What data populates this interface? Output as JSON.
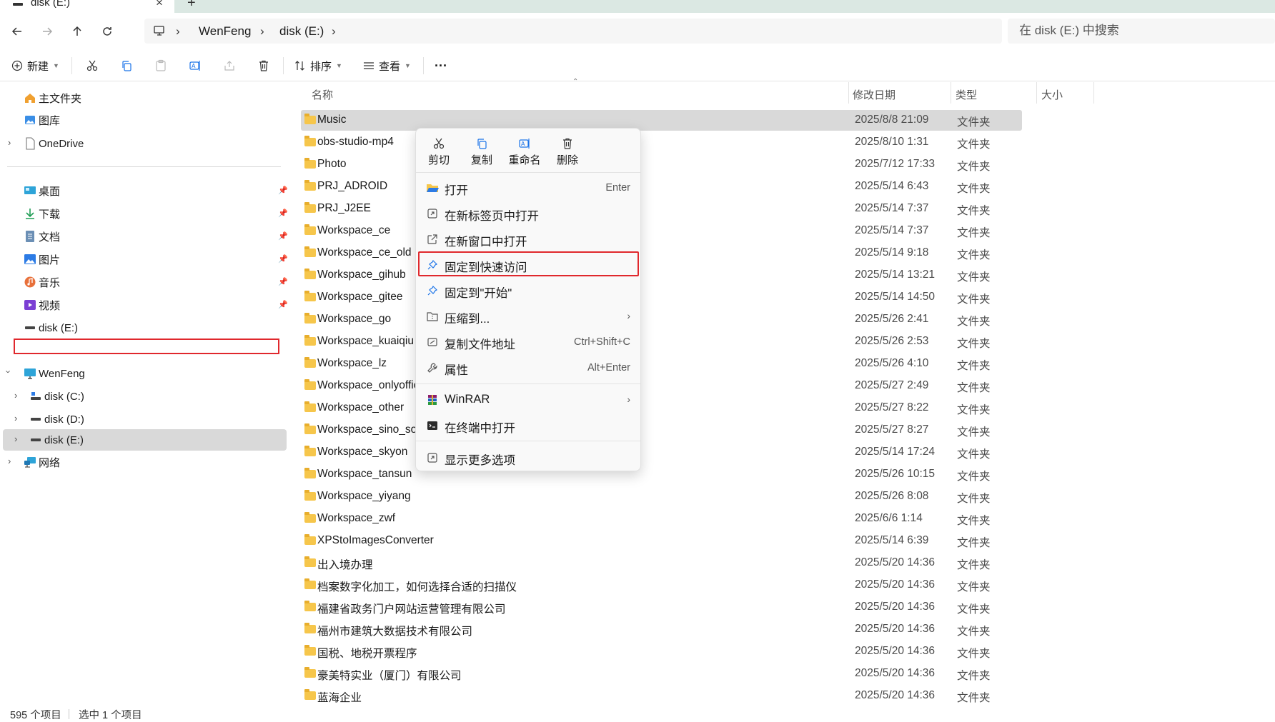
{
  "tab": {
    "label": "disk (E:)",
    "close": "×",
    "new_tab": "+"
  },
  "address": {
    "segments": [
      "WenFeng",
      "disk (E:)"
    ],
    "separator": "›"
  },
  "search": {
    "placeholder": "在 disk (E:) 中搜索"
  },
  "toolbar": {
    "new_label": "新建",
    "sort_label": "排序",
    "view_label": "查看",
    "more": "···"
  },
  "sidebar": {
    "home": "主文件夹",
    "gallery": "图库",
    "onedrive": "OneDrive",
    "quick": [
      {
        "label": "桌面",
        "icon": "desktop-icon"
      },
      {
        "label": "下载",
        "icon": "download-icon"
      },
      {
        "label": "文档",
        "icon": "document-icon"
      },
      {
        "label": "图片",
        "icon": "pictures-icon"
      },
      {
        "label": "音乐",
        "icon": "music-icon"
      },
      {
        "label": "视频",
        "icon": "video-icon"
      },
      {
        "label": "disk (E:)",
        "icon": "drive-icon"
      }
    ],
    "pc": "WenFeng",
    "drives": [
      "disk (C:)",
      "disk (D:)",
      "disk (E:)"
    ],
    "network": "网络"
  },
  "columns": {
    "name": "名称",
    "date": "修改日期",
    "type": "类型",
    "size": "大小"
  },
  "files": [
    {
      "name": "Music",
      "date": "2025/8/8 21:09",
      "type": "文件夹"
    },
    {
      "name": "obs-studio-mp4",
      "date": "2025/8/10 1:31",
      "type": "文件夹"
    },
    {
      "name": "Photo",
      "date": "2025/7/12 17:33",
      "type": "文件夹"
    },
    {
      "name": "PRJ_ADROID",
      "date": "2025/5/14 6:43",
      "type": "文件夹"
    },
    {
      "name": "PRJ_J2EE",
      "date": "2025/5/14 7:37",
      "type": "文件夹"
    },
    {
      "name": "Workspace_ce",
      "date": "2025/5/14 7:37",
      "type": "文件夹"
    },
    {
      "name": "Workspace_ce_old",
      "date": "2025/5/14 9:18",
      "type": "文件夹"
    },
    {
      "name": "Workspace_gihub",
      "date": "2025/5/14 13:21",
      "type": "文件夹"
    },
    {
      "name": "Workspace_gitee",
      "date": "2025/5/14 14:50",
      "type": "文件夹"
    },
    {
      "name": "Workspace_go",
      "date": "2025/5/26 2:41",
      "type": "文件夹"
    },
    {
      "name": "Workspace_kuaiqiu",
      "date": "2025/5/26 2:53",
      "type": "文件夹"
    },
    {
      "name": "Workspace_lz",
      "date": "2025/5/26 4:10",
      "type": "文件夹"
    },
    {
      "name": "Workspace_onlyoffice",
      "date": "2025/5/27 2:49",
      "type": "文件夹"
    },
    {
      "name": "Workspace_other",
      "date": "2025/5/27 8:22",
      "type": "文件夹"
    },
    {
      "name": "Workspace_sino_soft",
      "date": "2025/5/27 8:27",
      "type": "文件夹"
    },
    {
      "name": "Workspace_skyon",
      "date": "2025/5/14 17:24",
      "type": "文件夹"
    },
    {
      "name": "Workspace_tansun",
      "date": "2025/5/26 10:15",
      "type": "文件夹"
    },
    {
      "name": "Workspace_yiyang",
      "date": "2025/5/26 8:08",
      "type": "文件夹"
    },
    {
      "name": "Workspace_zwf",
      "date": "2025/6/6 1:14",
      "type": "文件夹"
    },
    {
      "name": "XPStoImagesConverter",
      "date": "2025/5/14 6:39",
      "type": "文件夹"
    },
    {
      "name": "出入境办理",
      "date": "2025/5/20 14:36",
      "type": "文件夹"
    },
    {
      "name": "档案数字化加工，如何选择合适的扫描仪",
      "date": "2025/5/20 14:36",
      "type": "文件夹"
    },
    {
      "name": "福建省政务门户网站运营管理有限公司",
      "date": "2025/5/20 14:36",
      "type": "文件夹"
    },
    {
      "name": "福州市建筑大数据技术有限公司",
      "date": "2025/5/20 14:36",
      "type": "文件夹"
    },
    {
      "name": "国税、地税开票程序",
      "date": "2025/5/20 14:36",
      "type": "文件夹"
    },
    {
      "name": "豪美特实业（厦门）有限公司",
      "date": "2025/5/20 14:36",
      "type": "文件夹"
    },
    {
      "name": "蓝海企业",
      "date": "2025/5/20 14:36",
      "type": "文件夹"
    }
  ],
  "context_menu": {
    "quick_actions": [
      {
        "label": "剪切",
        "icon": "scissors-icon"
      },
      {
        "label": "复制",
        "icon": "copy-icon"
      },
      {
        "label": "重命名",
        "icon": "rename-icon"
      },
      {
        "label": "删除",
        "icon": "trash-icon"
      }
    ],
    "items": [
      {
        "label": "打开",
        "shortcut": "Enter",
        "icon": "folder-open-icon"
      },
      {
        "label": "在新标签页中打开",
        "shortcut": "",
        "icon": "new-tab-icon"
      },
      {
        "label": "在新窗口中打开",
        "shortcut": "",
        "icon": "new-window-icon"
      },
      {
        "label": "固定到快速访问",
        "shortcut": "",
        "icon": "pin-icon"
      },
      {
        "label": "固定到\"开始\"",
        "shortcut": "",
        "icon": "pin-start-icon"
      },
      {
        "label": "压缩到...",
        "shortcut": "",
        "icon": "zip-icon"
      },
      {
        "label": "复制文件地址",
        "shortcut": "Ctrl+Shift+C",
        "icon": "copy-path-icon"
      },
      {
        "label": "属性",
        "shortcut": "Alt+Enter",
        "icon": "wrench-icon"
      },
      {
        "label": "WinRAR",
        "shortcut": "",
        "icon": "winrar-icon"
      },
      {
        "label": "在终端中打开",
        "shortcut": "",
        "icon": "terminal-icon"
      },
      {
        "label": "显示更多选项",
        "shortcut": "",
        "icon": "more-options-icon"
      }
    ],
    "submenu_arrow": "›"
  },
  "status": {
    "count": "595 个项目",
    "selected": "选中 1 个项目"
  },
  "colors": {
    "accent": "#1a73e8",
    "highlight_red": "#e0282d",
    "selection_gray": "#d9d9d9",
    "folder_yellow": "#f6c64b"
  }
}
